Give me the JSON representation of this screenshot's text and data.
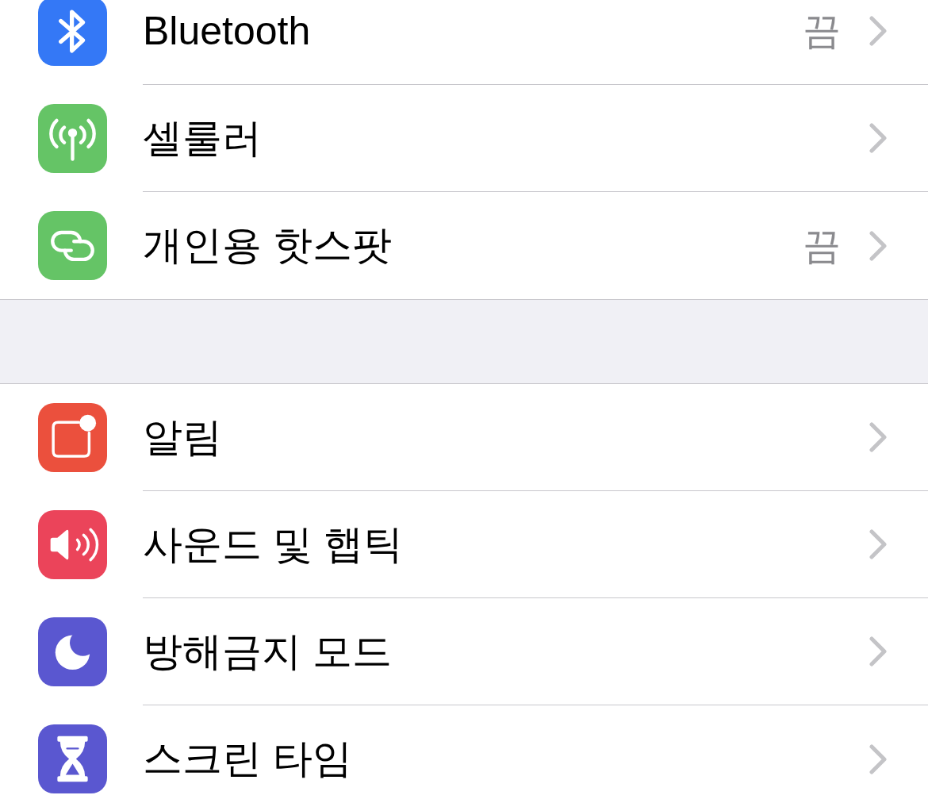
{
  "sections": [
    {
      "items": [
        {
          "label": "Bluetooth",
          "value": "끔",
          "color": "#3478f6"
        },
        {
          "label": "셀룰러",
          "color": "#65c466"
        },
        {
          "label": "개인용 핫스팟",
          "value": "끔",
          "color": "#65c466"
        }
      ]
    },
    {
      "items": [
        {
          "label": "알림",
          "color": "#eb503d"
        },
        {
          "label": "사운드 및 햅틱",
          "color": "#eb445a"
        },
        {
          "label": "방해금지 모드",
          "color": "#5a57d0"
        },
        {
          "label": "스크린 타임",
          "color": "#5a57d0"
        }
      ]
    }
  ]
}
